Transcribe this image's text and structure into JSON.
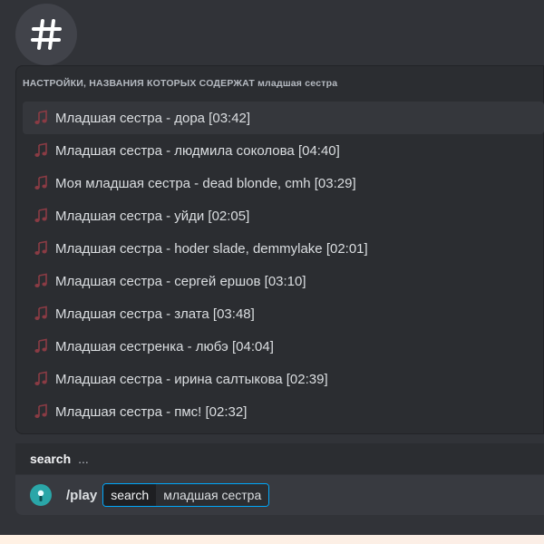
{
  "channel": {
    "icon": "hash-icon"
  },
  "autocomplete": {
    "header_prefix": "НАСТРОЙКИ, НАЗВАНИЯ КОТОРЫХ СОДЕРЖАТ",
    "header_query": "младшая сестра",
    "items": [
      {
        "label": "Младшая сестра - дора [03:42]",
        "icon": "music-note-icon"
      },
      {
        "label": "Младшая сестра - людмила соколова [04:40]",
        "icon": "music-note-icon"
      },
      {
        "label": "Моя младшая сестра - dead blonde, cmh [03:29]",
        "icon": "music-note-icon"
      },
      {
        "label": "Младшая сестра - уйди [02:05]",
        "icon": "music-note-icon"
      },
      {
        "label": "Младшая сестра - hoder slade, demmylake [02:01]",
        "icon": "music-note-icon"
      },
      {
        "label": "Младшая сестра - сергей ершов [03:10]",
        "icon": "music-note-icon"
      },
      {
        "label": "Младшая сестра - злата [03:48]",
        "icon": "music-note-icon"
      },
      {
        "label": "Младшая сестренка - любэ [04:04]",
        "icon": "music-note-icon"
      },
      {
        "label": "Младшая сестра - ирина салтыкова [02:39]",
        "icon": "music-note-icon"
      },
      {
        "label": "Младшая сестра - пмс! [02:32]",
        "icon": "music-note-icon"
      }
    ]
  },
  "options_bar": {
    "option_name": "search",
    "more": "..."
  },
  "input": {
    "command": "/play",
    "option_key": "search",
    "option_value": "младшая сестра"
  },
  "colors": {
    "accent": "#00a8fc",
    "note": "#e8636f",
    "background": "#313338"
  }
}
